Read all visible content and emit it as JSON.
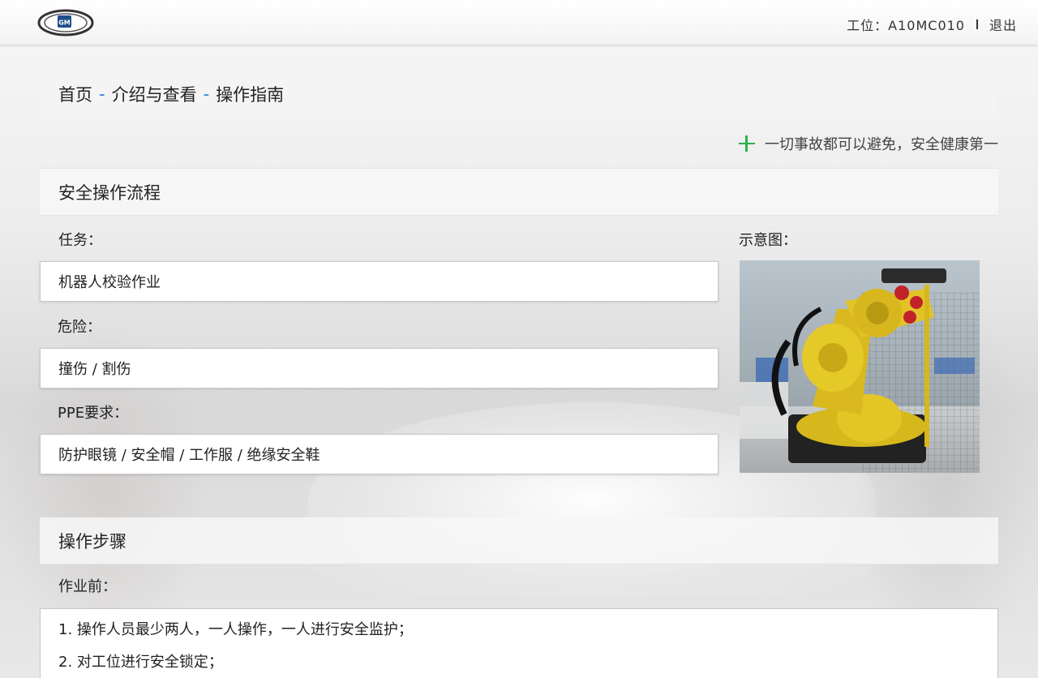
{
  "header": {
    "logo_text": "GM",
    "station_label": "工位：A10MC010",
    "logout_label": "退出"
  },
  "breadcrumb": {
    "items": [
      "首页",
      "介绍与查看",
      "操作指南"
    ],
    "separator": "-"
  },
  "slogan": "一切事故都可以避免，安全健康第一",
  "safety_flow": {
    "title": "安全操作流程",
    "task_label": "任务：",
    "task_value": "机器人校验作业",
    "danger_label": "危险：",
    "danger_value": "撞伤 / 割伤",
    "ppe_label": "PPE要求：",
    "ppe_value": "防护眼镜 / 安全帽 / 工作服 / 绝缘安全鞋",
    "diagram_label": "示意图："
  },
  "steps": {
    "title": "操作步骤",
    "before_label": "作业前：",
    "before_items": [
      "1. 操作人员最少两人，一人操作，一人进行安全监护；",
      "2. 对工位进行安全锁定；"
    ]
  },
  "colors": {
    "accent_blue": "#2a7fd4",
    "cross_green": "#29b34a"
  }
}
